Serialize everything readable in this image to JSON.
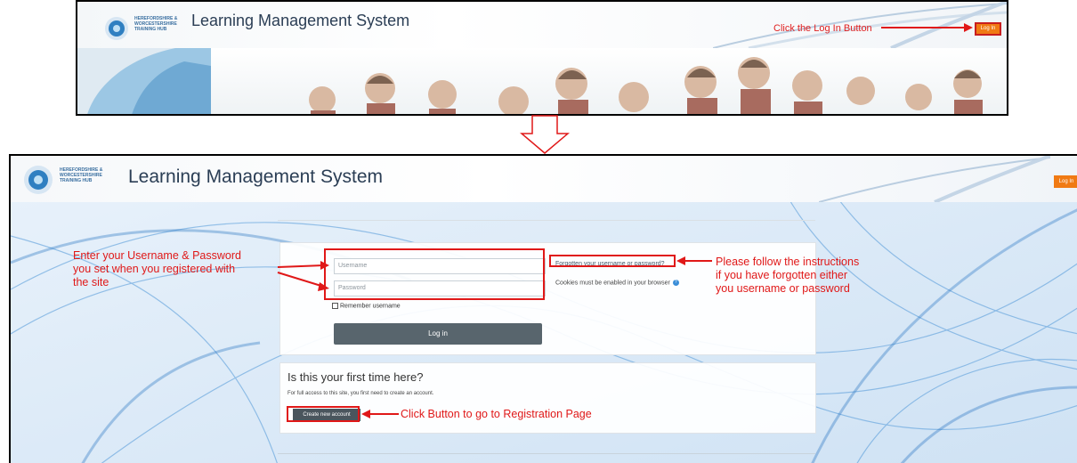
{
  "top_screenshot": {
    "logo_text": "HEREFORDSHIRE & WORCESTERSHIRE TRAINING HUB",
    "site_title": "Learning Management System",
    "annotation": "Click the Log In Button",
    "login_button": "Log In"
  },
  "bottom_screenshot": {
    "logo_text": "HEREFORDSHIRE & WORCESTERSHIRE TRAINING HUB",
    "site_title": "Learning Management System",
    "login_button": "Log In",
    "login_form": {
      "username_placeholder": "Username",
      "password_placeholder": "Password",
      "remember_label": "Remember username",
      "login_button": "Log in",
      "forgot_link": "Forgotten your username or password?",
      "cookies_notice": "Cookies must be enabled in your browser"
    },
    "first_time": {
      "heading": "Is this your first time here?",
      "text": "For full access to this site, you first need to create an account.",
      "create_button": "Create new account"
    }
  },
  "annotations": {
    "credentials": "Enter your Username & Password\nyou set when you registered with\nthe site",
    "forgot": "Please follow the instructions\nif you have forgotten either\nyou username or password",
    "registration": "Click Button to go to Registration Page"
  },
  "colors": {
    "annotation_red": "#e01818",
    "login_orange": "#f07a14",
    "title_navy": "#2b3e55",
    "button_slate": "#58656d"
  }
}
